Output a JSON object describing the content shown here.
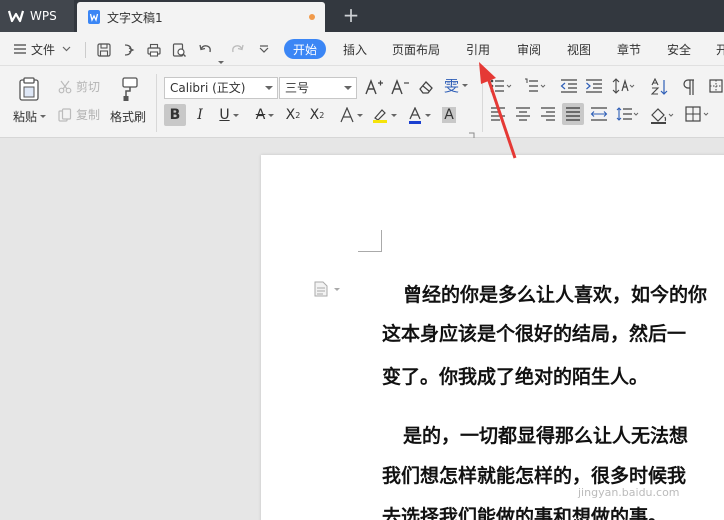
{
  "titlebar": {
    "app_tab": "WPS",
    "doc_tab": "文字文稿1",
    "new_tab": "+"
  },
  "menubar": {
    "file_menu": "文件",
    "tabs": [
      "开始",
      "插入",
      "页面布局",
      "引用",
      "审阅",
      "视图",
      "章节",
      "安全",
      "开"
    ]
  },
  "ribbon": {
    "paste": "粘贴",
    "cut": "剪切",
    "copy": "复制",
    "format_painter": "格式刷",
    "font_name": "Calibri (正文)",
    "font_size": "三号",
    "pinyin": "雯"
  },
  "document": {
    "lines": [
      "曾经的你是多么让人喜欢，如今的你",
      "这本身应该是个很好的结局，然后一",
      "变了。你我成了绝对的陌生人。",
      "是的，一切都显得那么让人无法想",
      "我们想怎样就能怎样的，很多时候我",
      "去选择我们能做的事和想做的事。"
    ]
  },
  "watermark": "jingyan.baidu.com",
  "colors": {
    "accent": "#3b86f5",
    "titlebar": "#33383f",
    "annotation": "#e53935"
  }
}
